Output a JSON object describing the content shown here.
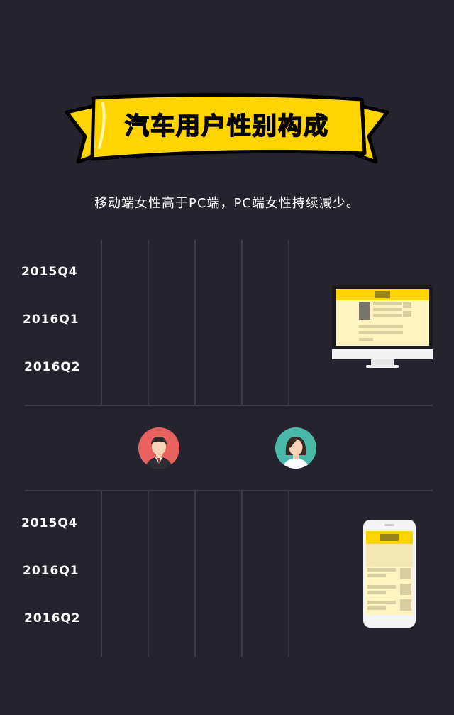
{
  "title": "汽车用户性别构成",
  "subtitle": "移动端女性高于PC端，PC端女性持续减少。",
  "chart_data": [
    {
      "type": "bar",
      "panel": "PC",
      "categories": [
        "2015Q4",
        "2016Q1",
        "2016Q2"
      ],
      "series": []
    },
    {
      "type": "bar",
      "panel": "mobile",
      "categories": [
        "2015Q4",
        "2016Q1",
        "2016Q2"
      ],
      "series": []
    }
  ],
  "legend": {
    "male_icon": "male-avatar-icon",
    "female_icon": "female-avatar-icon",
    "male_color": "#e8615f",
    "female_color": "#4ab8a8"
  },
  "colors": {
    "background": "#25242e",
    "banner": "#ffd400",
    "grid": "#3d3c48"
  },
  "device_icons": [
    "desktop-monitor-icon",
    "smartphone-icon"
  ]
}
